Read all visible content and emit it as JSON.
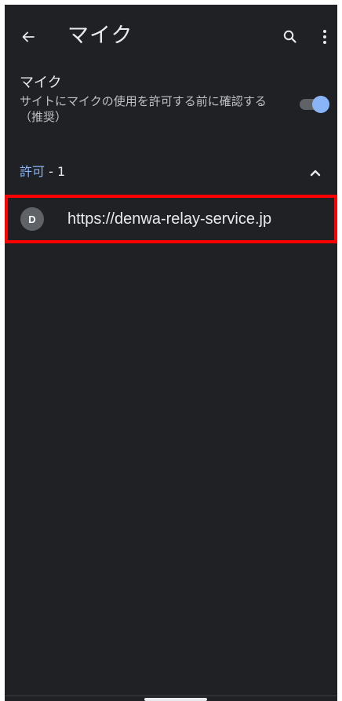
{
  "appbar": {
    "title": "マイク",
    "back_icon": "arrow-left-icon",
    "search_icon": "search-icon",
    "menu_icon": "more-vert-icon"
  },
  "setting": {
    "title": "マイク",
    "summary": "サイトにマイクの使用を許可する前に確認する（推奨）",
    "toggle_on": true
  },
  "section": {
    "label": "許可",
    "count": " - 1",
    "expanded": true,
    "collapse_icon": "chevron-up-icon"
  },
  "sites": [
    {
      "favicon_letter": "D",
      "url": "https://denwa-relay-service.jp"
    }
  ],
  "colors": {
    "background": "#202124",
    "accent": "#8ab4f8",
    "highlight": "#ff0000"
  }
}
